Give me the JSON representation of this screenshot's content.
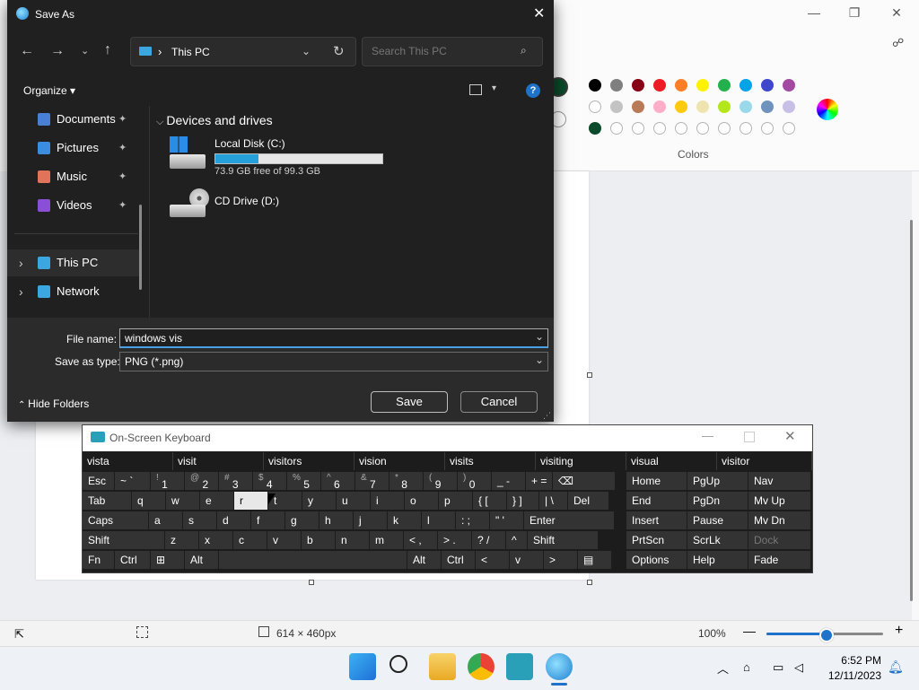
{
  "paint": {
    "colors_label": "Colors",
    "swatch_row1": [
      "#000000",
      "#7f7f7f",
      "#880015",
      "#ed1c24",
      "#ff7f27",
      "#fff200",
      "#22b14c",
      "#00a2e8",
      "#3f48cc",
      "#a349a4"
    ],
    "swatch_row2": [
      "#ffffff",
      "#c3c3c3",
      "#b97a57",
      "#ffaec9",
      "#ffc90e",
      "#efe4b0",
      "#b5e61d",
      "#99d9ea",
      "#7092be",
      "#c8bfe7"
    ],
    "swatch_row3": [
      "#0b4a2a",
      "#ffffff",
      "#ffffff",
      "#ffffff",
      "#ffffff",
      "#ffffff",
      "#ffffff",
      "#ffffff",
      "#ffffff",
      "#ffffff"
    ],
    "status": {
      "canvas_size": "614 × 460px",
      "zoom": "100%",
      "zoom_level": 0.5
    }
  },
  "save_as": {
    "title": "Save As",
    "address": "This PC",
    "search_placeholder": "Search This PC",
    "organize": "Organize",
    "nav_items": [
      {
        "label": "Documents",
        "icon": "documents-icon",
        "color": "#4a7fd6",
        "pinned": true
      },
      {
        "label": "Pictures",
        "icon": "pictures-icon",
        "color": "#3a8de0",
        "pinned": true
      },
      {
        "label": "Music",
        "icon": "music-icon",
        "color": "#e0735a",
        "pinned": true
      },
      {
        "label": "Videos",
        "icon": "videos-icon",
        "color": "#8a4fd6",
        "pinned": true
      },
      {
        "label": "This PC",
        "icon": "this-pc-icon",
        "color": "#3ba7e0",
        "pinned": false
      },
      {
        "label": "Network",
        "icon": "network-icon",
        "color": "#3ba7e0",
        "pinned": false
      }
    ],
    "section_header": "Devices and drives",
    "drives": [
      {
        "name": "Local Disk (C:)",
        "free": "73.9 GB free of 99.3 GB",
        "used_fraction": 0.256
      },
      {
        "name": "CD Drive (D:)"
      }
    ],
    "file_name_label": "File name:",
    "file_name_value": "windows vis",
    "save_type_label": "Save as type:",
    "save_type_value": "PNG (*.png)",
    "hide_folders": "Hide Folders",
    "save_button": "Save",
    "cancel_button": "Cancel"
  },
  "keyboard": {
    "title": "On-Screen Keyboard",
    "suggestions": [
      "vista",
      "visit",
      "visitors",
      "vision",
      "visits",
      "visiting",
      "visual",
      "visitor"
    ],
    "rows": [
      [
        {
          "m": "Esc",
          "w": 36
        },
        {
          "m": "~ `",
          "w": 40
        },
        {
          "s": "!",
          "m": "1",
          "w": 38
        },
        {
          "s": "@",
          "m": "2",
          "w": 38
        },
        {
          "s": "#",
          "m": "3",
          "w": 38
        },
        {
          "s": "$",
          "m": "4",
          "w": 38
        },
        {
          "s": "%",
          "m": "5",
          "w": 38
        },
        {
          "s": "^",
          "m": "6",
          "w": 38
        },
        {
          "s": "&",
          "m": "7",
          "w": 38
        },
        {
          "s": "*",
          "m": "8",
          "w": 38
        },
        {
          "s": "(",
          "m": "9",
          "w": 38
        },
        {
          "s": ")",
          "m": "0",
          "w": 38
        },
        {
          "m": "_ -",
          "w": 38
        },
        {
          "m": "+ =",
          "w": 30
        },
        {
          "m": "⌫",
          "w": 70
        }
      ],
      [
        {
          "m": "Tab",
          "w": 55
        },
        {
          "m": "q",
          "w": 38
        },
        {
          "m": "w",
          "w": 38
        },
        {
          "m": "e",
          "w": 38
        },
        {
          "m": "r",
          "w": 38,
          "hl": true
        },
        {
          "m": "t",
          "w": 38
        },
        {
          "m": "y",
          "w": 38
        },
        {
          "m": "u",
          "w": 38
        },
        {
          "m": "i",
          "w": 38
        },
        {
          "m": "o",
          "w": 38
        },
        {
          "m": "p",
          "w": 38
        },
        {
          "m": "{ [",
          "w": 38
        },
        {
          "m": "} ]",
          "w": 36
        },
        {
          "m": "| \\",
          "w": 32
        },
        {
          "m": "Del",
          "w": 46
        }
      ],
      [
        {
          "m": "Caps",
          "w": 74
        },
        {
          "m": "a",
          "w": 38
        },
        {
          "m": "s",
          "w": 38
        },
        {
          "m": "d",
          "w": 38
        },
        {
          "m": "f",
          "w": 38
        },
        {
          "m": "g",
          "w": 38
        },
        {
          "m": "h",
          "w": 38
        },
        {
          "m": "j",
          "w": 38
        },
        {
          "m": "k",
          "w": 38
        },
        {
          "m": "l",
          "w": 38
        },
        {
          "m": ": ;",
          "w": 38
        },
        {
          "m": "\" '",
          "w": 38
        },
        {
          "m": "Enter",
          "w": 101
        }
      ],
      [
        {
          "m": "Shift",
          "w": 92
        },
        {
          "m": "z",
          "w": 38
        },
        {
          "m": "x",
          "w": 38
        },
        {
          "m": "c",
          "w": 38
        },
        {
          "m": "v",
          "w": 38
        },
        {
          "m": "b",
          "w": 38
        },
        {
          "m": "n",
          "w": 38
        },
        {
          "m": "m",
          "w": 38
        },
        {
          "m": "< ,",
          "w": 38
        },
        {
          "m": "> .",
          "w": 38
        },
        {
          "m": "? /",
          "w": 38
        },
        {
          "m": "^",
          "w": 24
        },
        {
          "m": "Shift",
          "w": 79
        }
      ],
      [
        {
          "m": "Fn",
          "w": 36
        },
        {
          "m": "Ctrl",
          "w": 40
        },
        {
          "m": "⊞",
          "w": 38
        },
        {
          "m": "Alt",
          "w": 38
        },
        {
          "m": "",
          "w": 210
        },
        {
          "m": "Alt",
          "w": 38
        },
        {
          "m": "Ctrl",
          "w": 38
        },
        {
          "m": "<",
          "w": 38
        },
        {
          "m": "v",
          "w": 38
        },
        {
          "m": ">",
          "w": 38
        },
        {
          "m": "▤",
          "w": 38
        }
      ]
    ],
    "side_rows": [
      [
        "Home",
        "PgUp",
        "Nav"
      ],
      [
        "End",
        "PgDn",
        "Mv Up"
      ],
      [
        "Insert",
        "Pause",
        "Mv Dn"
      ],
      [
        "PrtScn",
        "ScrLk",
        "Dock"
      ],
      [
        "Options",
        "Help",
        "Fade"
      ]
    ]
  },
  "taskbar": {
    "time": "6:52 PM",
    "date": "12/11/2023"
  }
}
